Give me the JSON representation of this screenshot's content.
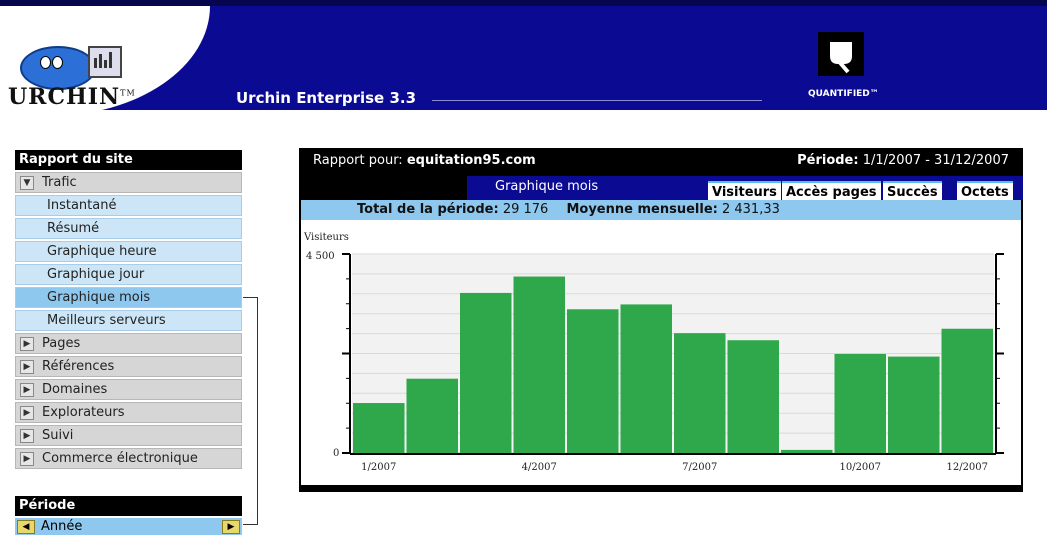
{
  "header": {
    "logo_text": "URCHIN",
    "logo_tm": "TM",
    "product_title": "Urchin Enterprise 3.3",
    "partner_text": "QUANTIFIED™"
  },
  "sidebar": {
    "heading": "Rapport du site",
    "categories": [
      {
        "label": "Trafic",
        "expanded": true,
        "icon": "triangle-down-icon"
      },
      {
        "label": "Pages",
        "icon": "triangle-right-icon"
      },
      {
        "label": "Références",
        "icon": "triangle-right-icon"
      },
      {
        "label": "Domaines",
        "icon": "triangle-right-icon"
      },
      {
        "label": "Explorateurs",
        "icon": "triangle-right-icon"
      },
      {
        "label": "Suivi",
        "icon": "triangle-right-icon"
      },
      {
        "label": "Commerce électronique",
        "icon": "triangle-right-icon"
      }
    ],
    "trafic_items": [
      "Instantané",
      "Résumé",
      "Graphique heure",
      "Graphique jour",
      "Graphique mois",
      "Meilleurs serveurs"
    ],
    "active_item": "Graphique mois"
  },
  "period": {
    "heading": "Période",
    "value": "Année"
  },
  "report": {
    "for_label": "Rapport pour:",
    "site": "equitation95.com",
    "period_label": "Période:",
    "period_value": "1/1/2007 - 31/12/2007",
    "graph_title": "Graphique mois",
    "tabs": [
      "Visiteurs",
      "Accès pages",
      "Succès",
      "Octets"
    ],
    "active_tab": "Visiteurs",
    "total_label": "Total de la période:",
    "total_value": "29 176",
    "avg_label": "Moyenne mensuelle:",
    "avg_value": "2 431,33"
  },
  "colors": {
    "header_bg": "#0a0a93",
    "bar": "#2ea84a",
    "light_blue": "#8fc8ef",
    "pale_blue": "#cde6f7"
  },
  "chart_data": {
    "type": "bar",
    "ylabel": "Visiteurs",
    "ylim": [
      0,
      4500
    ],
    "ytick_labels": [
      "0",
      "4 500"
    ],
    "categories": [
      "1/2007",
      "2/2007",
      "3/2007",
      "4/2007",
      "5/2007",
      "6/2007",
      "7/2007",
      "8/2007",
      "9/2007",
      "10/2007",
      "11/2007",
      "12/2007"
    ],
    "xtick_labels": {
      "0": "1/2007",
      "3": "4/2007",
      "6": "7/2007",
      "9": "10/2007",
      "11": "12/2007"
    },
    "values": [
      1130,
      1680,
      3620,
      3990,
      3250,
      3360,
      2710,
      2550,
      70,
      2240,
      2180,
      2810
    ],
    "grid": true
  }
}
